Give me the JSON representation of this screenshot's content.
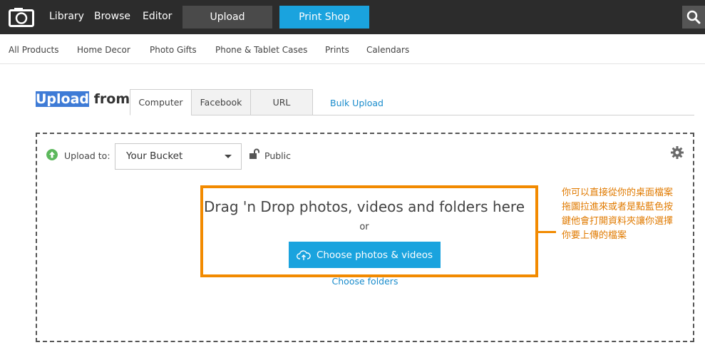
{
  "topnav": {
    "items": [
      "Library",
      "Browse",
      "Editor"
    ],
    "upload": "Upload",
    "print_shop": "Print Shop"
  },
  "subnav": {
    "items": [
      "All Products",
      "Home Decor",
      "Photo Gifts",
      "Phone & Tablet Cases",
      "Prints",
      "Calendars"
    ]
  },
  "upload_header": {
    "title_highlight": "Upload",
    "title_rest": " from:",
    "tabs": [
      "Computer",
      "Facebook",
      "URL"
    ],
    "bulk_upload": "Bulk Upload"
  },
  "dropzone": {
    "upload_to_label": "Upload to:",
    "bucket_value": "Your Bucket",
    "privacy_label": "Public",
    "drop_text": "Drag 'n Drop photos, videos and folders here",
    "or_text": "or",
    "choose_button": "Choose photos & videos",
    "choose_folders": "Choose folders"
  },
  "annotation": {
    "text": "你可以直接從你的桌面檔案拖圖拉進來或者是點藍色按鍵他會打開資料夾讓你選擇你要上傳的檔案"
  },
  "colors": {
    "topbar": "#2c2c2c",
    "accent": "#1aa3de",
    "annotation": "#f28a00"
  },
  "icons": [
    "logo-icon",
    "search-icon",
    "upload-arrow-icon",
    "caret-down-icon",
    "unlock-icon",
    "gear-icon",
    "cloud-upload-icon"
  ]
}
